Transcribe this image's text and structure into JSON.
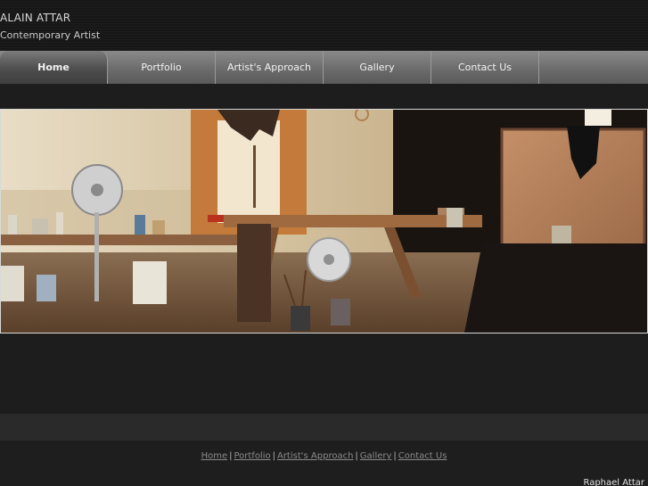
{
  "header": {
    "title": "ALAIN ATTAR",
    "subtitle": "Contemporary Artist"
  },
  "nav": {
    "items": [
      {
        "label": "Home",
        "active": true
      },
      {
        "label": "Portfolio",
        "active": false
      },
      {
        "label": "Artist's Approach",
        "active": false
      },
      {
        "label": "Gallery",
        "active": false
      },
      {
        "label": "Contact Us",
        "active": false
      }
    ]
  },
  "hero": {
    "subject": "artist-studio-photo"
  },
  "footer": {
    "links": [
      "Home",
      "Portfolio",
      "Artist's Approach",
      "Gallery",
      "Contact Us"
    ],
    "separator": "|",
    "credit": "Raphael Attar"
  },
  "colors": {
    "background": "#1b1b1b",
    "nav": "#6c6c6c",
    "nav_active": "#4e4e4e",
    "text": "#d8d8d8",
    "footer_link": "#8a8a8a"
  }
}
